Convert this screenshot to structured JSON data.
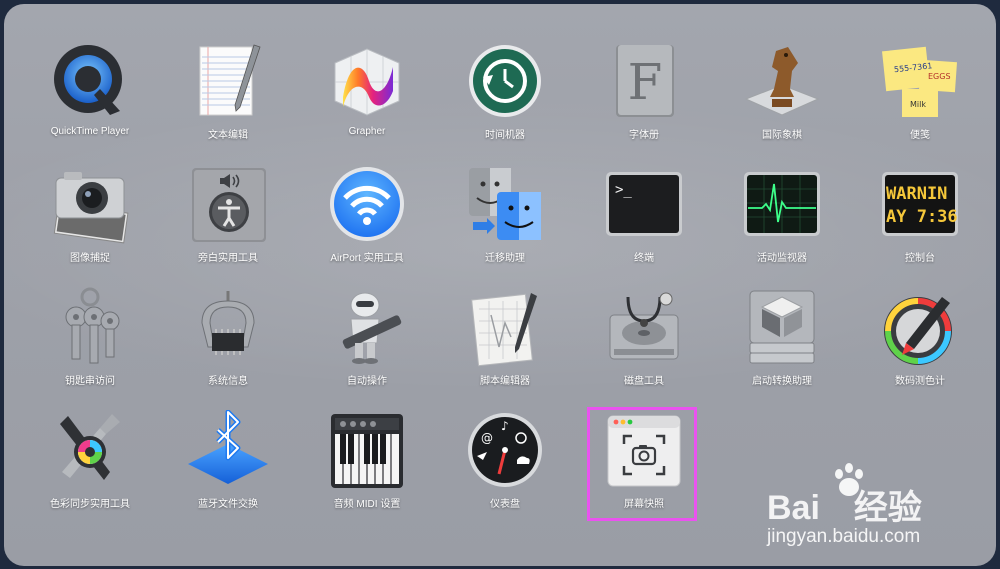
{
  "watermark": {
    "brand": "Bai",
    "brand_cn": "经验",
    "site": "jingyan.baidu.com"
  },
  "apps": [
    {
      "label": "QuickTime Player",
      "icon": "quicktime-icon"
    },
    {
      "label": "文本编辑",
      "icon": "textedit-icon"
    },
    {
      "label": "Grapher",
      "icon": "grapher-icon"
    },
    {
      "label": "时间机器",
      "icon": "time-machine-icon"
    },
    {
      "label": "字体册",
      "icon": "font-book-icon"
    },
    {
      "label": "国际象棋",
      "icon": "chess-icon"
    },
    {
      "label": "便笺",
      "icon": "stickies-icon"
    },
    {
      "label": "图像捕捉",
      "icon": "image-capture-icon"
    },
    {
      "label": "旁白实用工具",
      "icon": "voiceover-utility-icon"
    },
    {
      "label": "AirPort 实用工具",
      "icon": "airport-utility-icon"
    },
    {
      "label": "迁移助理",
      "icon": "migration-assistant-icon"
    },
    {
      "label": "终端",
      "icon": "terminal-icon"
    },
    {
      "label": "活动监视器",
      "icon": "activity-monitor-icon"
    },
    {
      "label": "控制台",
      "icon": "console-icon"
    },
    {
      "label": "钥匙串访问",
      "icon": "keychain-access-icon"
    },
    {
      "label": "系统信息",
      "icon": "system-information-icon"
    },
    {
      "label": "自动操作",
      "icon": "automator-icon"
    },
    {
      "label": "脚本编辑器",
      "icon": "script-editor-icon"
    },
    {
      "label": "磁盘工具",
      "icon": "disk-utility-icon"
    },
    {
      "label": "启动转换助理",
      "icon": "boot-camp-assistant-icon"
    },
    {
      "label": "数码测色计",
      "icon": "digital-color-meter-icon"
    },
    {
      "label": "色彩同步实用工具",
      "icon": "colorsync-utility-icon"
    },
    {
      "label": "蓝牙文件交换",
      "icon": "bluetooth-file-exchange-icon"
    },
    {
      "label": "音频 MIDI 设置",
      "icon": "audio-midi-setup-icon"
    },
    {
      "label": "仪表盘",
      "icon": "dashboard-icon"
    },
    {
      "label": "屏幕快照",
      "icon": "screenshot-icon"
    }
  ],
  "console_icon_text": [
    "WARNIN",
    "AY 7:36"
  ],
  "terminal_icon_text": ">_",
  "font_book_icon_text": "F",
  "stickies_icon_text": [
    "555-7361",
    "EGGS",
    "Milk"
  ],
  "colors": {
    "highlight": "#ea52ef",
    "label": "#ffffff"
  }
}
